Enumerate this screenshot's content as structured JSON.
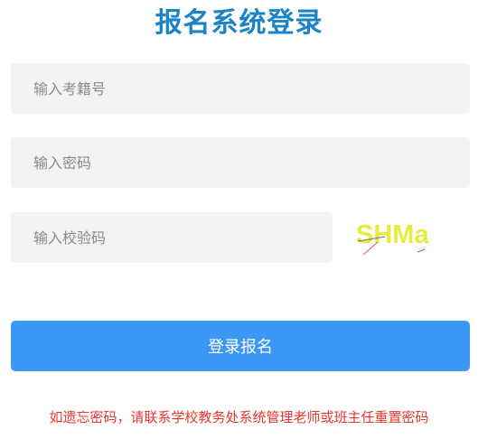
{
  "header": {
    "title": "报名系统登录"
  },
  "form": {
    "exam_id_placeholder": "输入考籍号",
    "password_placeholder": "输入密码",
    "captcha_placeholder": "输入校验码",
    "captcha_image_text": "SHMa",
    "submit_label": "登录报名"
  },
  "footer": {
    "notice": "如遗忘密码，请联系学校教务处系统管理老师或班主任重置密码"
  },
  "colors": {
    "title": "#1a84c6",
    "submit_button": "#3d97f5",
    "notice_text": "#e8372e",
    "input_background": "#f3f3f3",
    "captcha_text": "#e6ec3a"
  }
}
